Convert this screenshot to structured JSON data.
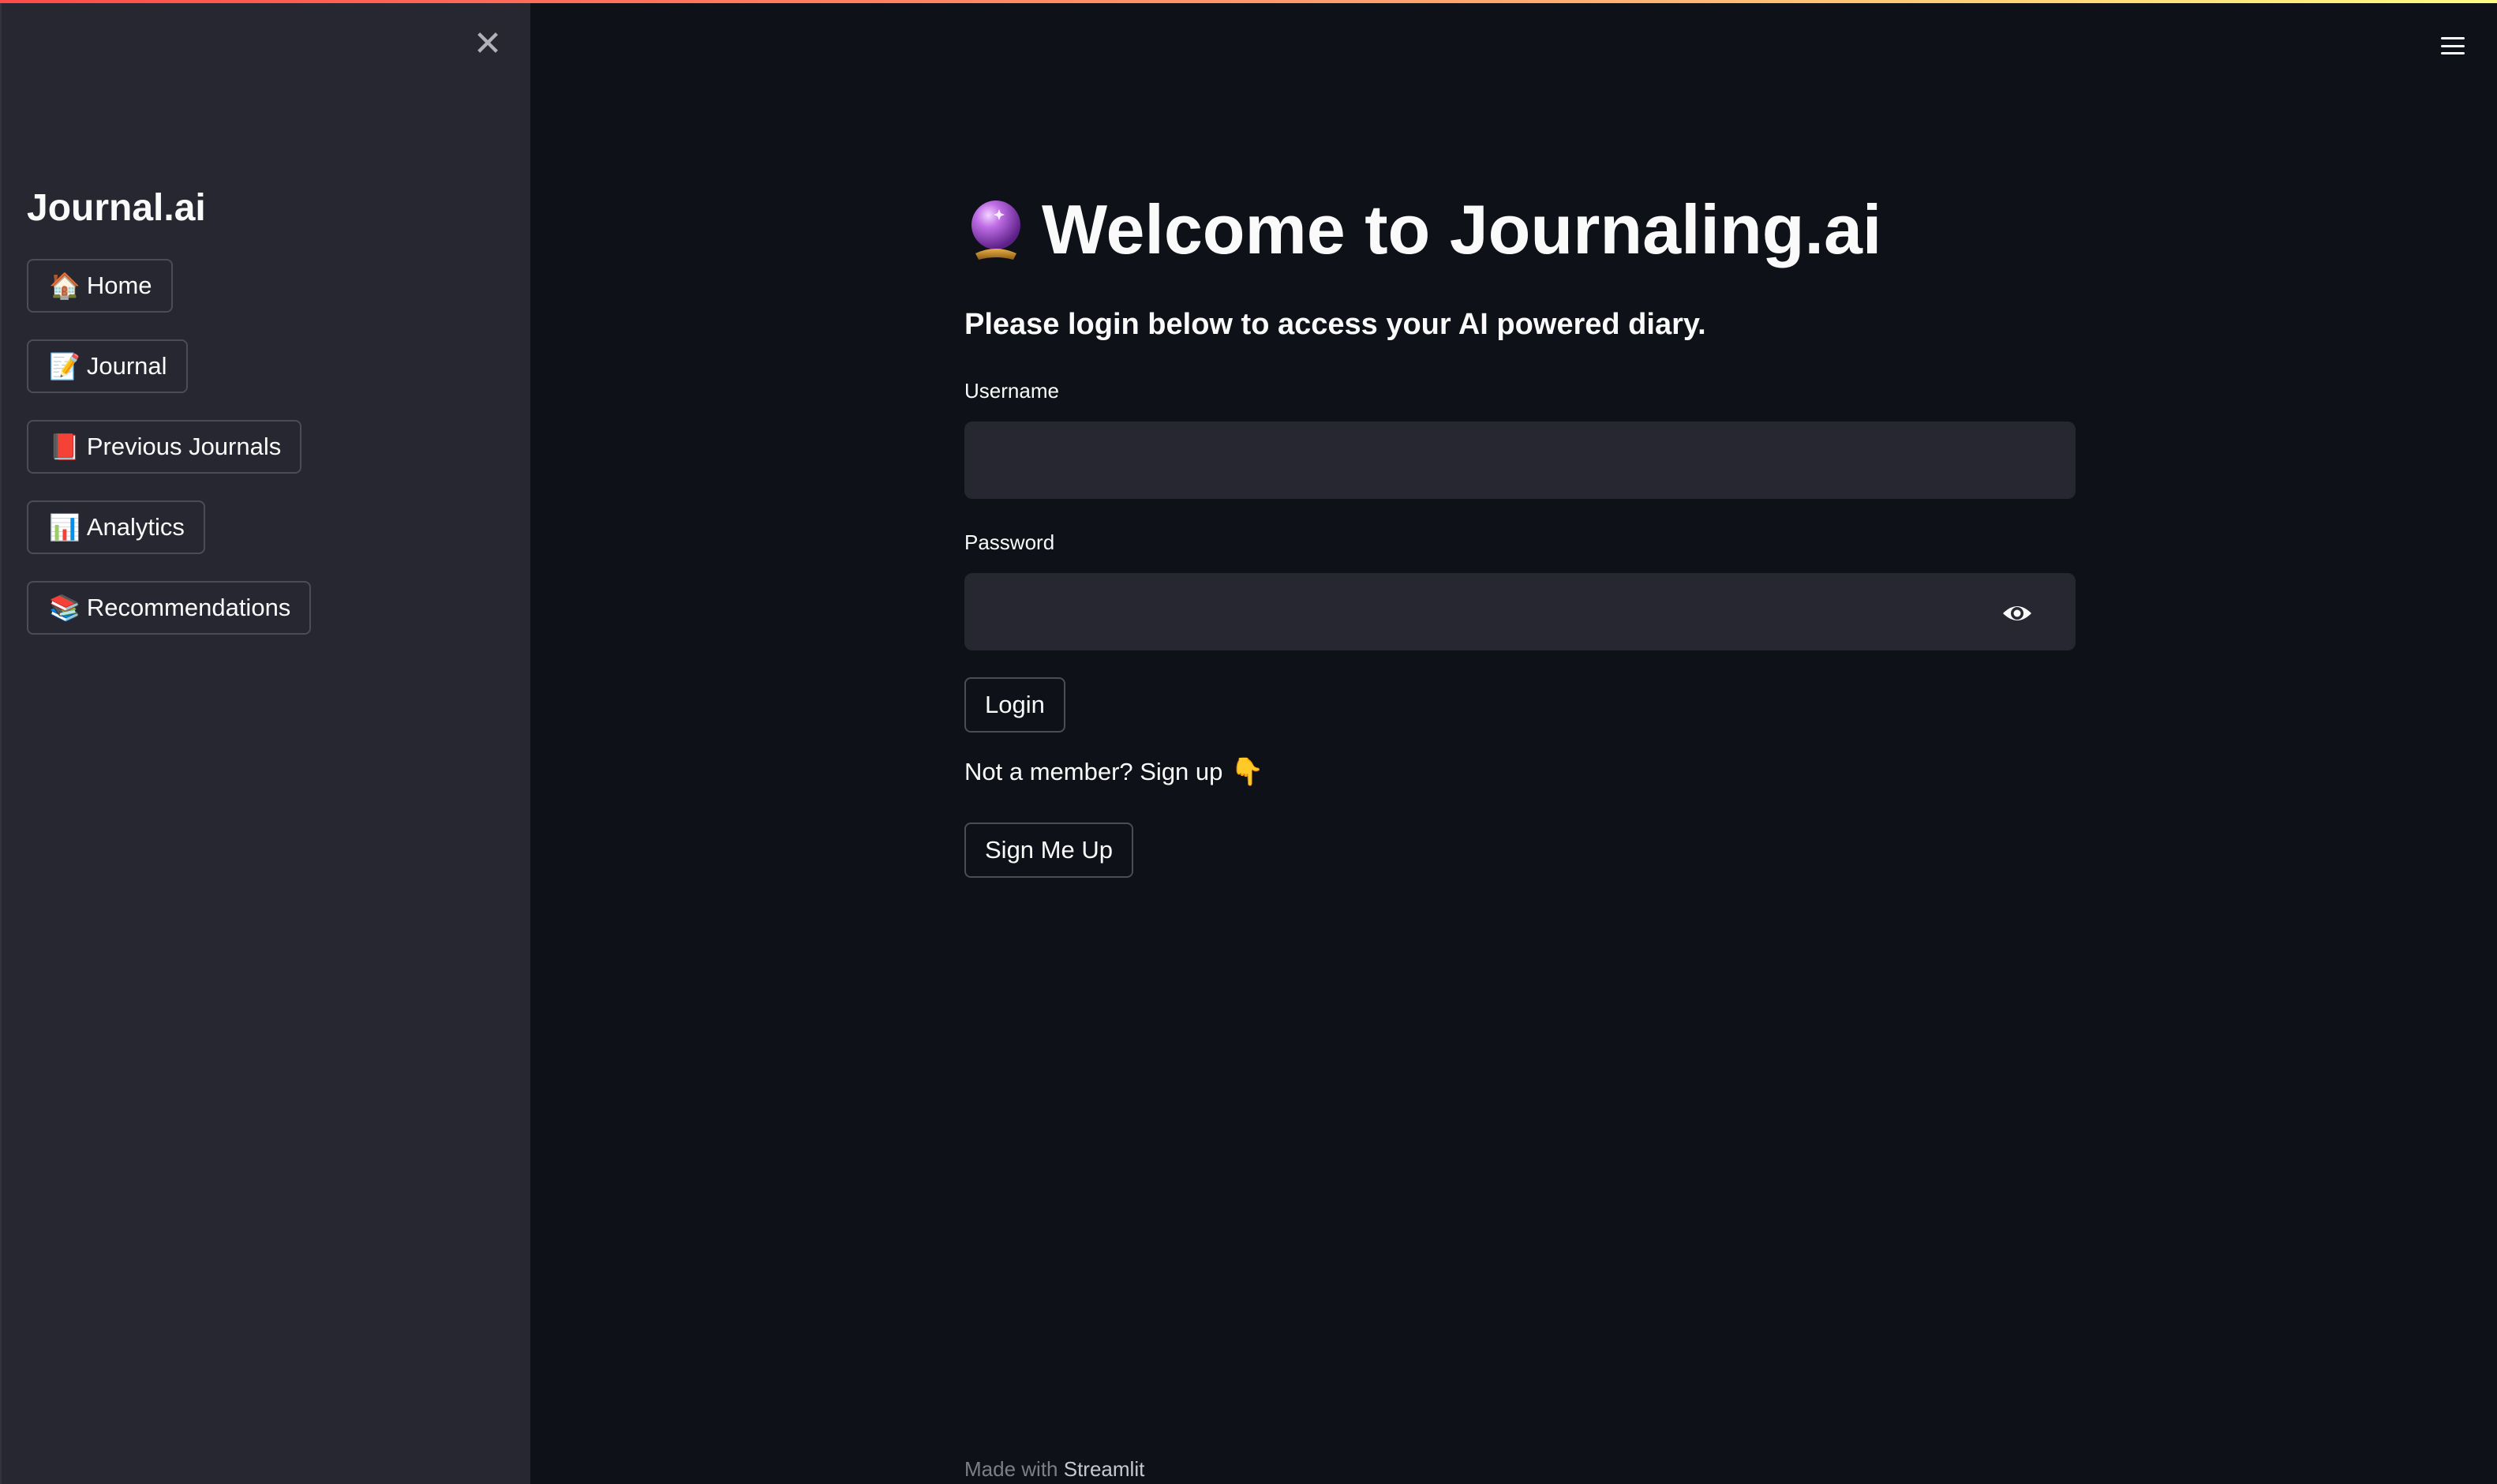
{
  "app": {
    "accent_gradient": [
      "#ff4b4b",
      "#ffa770",
      "#fffd80"
    ],
    "background": "#0e1117",
    "sidebar_background": "#262730"
  },
  "sidebar": {
    "close_icon": "close-icon",
    "title": "Journal.ai",
    "items": [
      {
        "emoji": "🏠",
        "label": "Home",
        "icon": "house-icon"
      },
      {
        "emoji": "📝",
        "label": "Journal",
        "icon": "memo-icon"
      },
      {
        "emoji": "📕",
        "label": "Previous Journals",
        "icon": "book-icon"
      },
      {
        "emoji": "📊",
        "label": "Analytics",
        "icon": "bar-chart-icon"
      },
      {
        "emoji": "📚",
        "label": "Recommendations",
        "icon": "books-icon"
      }
    ]
  },
  "header": {
    "menu_icon": "hamburger-menu-icon"
  },
  "main": {
    "title_icon": "crystal-ball-icon",
    "title": "Welcome to Journaling.ai",
    "subtitle": "Please login below to access your AI powered diary.",
    "username_label": "Username",
    "username_value": "",
    "password_label": "Password",
    "password_value": "",
    "password_toggle_icon": "eye-icon",
    "login_label": "Login",
    "signup_prompt": "Not a member? Sign up",
    "signup_prompt_emoji": "👇",
    "signup_label": "Sign Me Up"
  },
  "footer": {
    "prefix": "Made with",
    "brand": "Streamlit"
  }
}
